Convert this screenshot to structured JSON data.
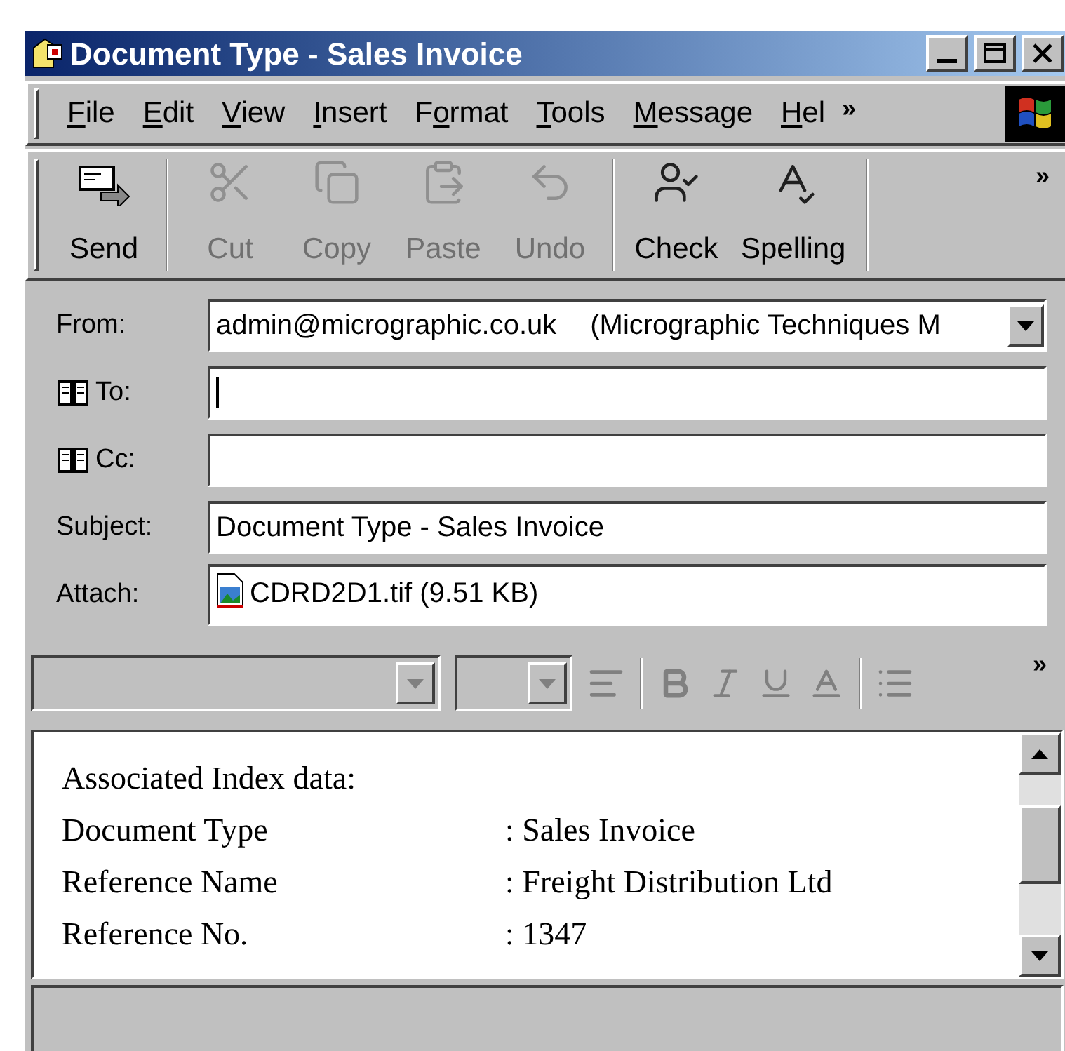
{
  "window": {
    "title": "Document Type - Sales Invoice"
  },
  "menu": [
    {
      "key": "F",
      "after": "ile"
    },
    {
      "key": "E",
      "after": "dit"
    },
    {
      "key": "V",
      "after": "iew"
    },
    {
      "key": "I",
      "after": "nsert"
    },
    {
      "before": "F",
      "key": "o",
      "after": "rmat"
    },
    {
      "key": "T",
      "after": "ools"
    },
    {
      "key": "M",
      "after": "essage"
    },
    {
      "key": "H",
      "after": "el"
    }
  ],
  "menu_overflow": "»",
  "toolbar": [
    {
      "kind": "send",
      "label": "Send",
      "disabled": false
    },
    {
      "kind": "cut",
      "label": "Cut",
      "disabled": true
    },
    {
      "kind": "copy",
      "label": "Copy",
      "disabled": true
    },
    {
      "kind": "paste",
      "label": "Paste",
      "disabled": true
    },
    {
      "kind": "undo",
      "label": "Undo",
      "disabled": true
    },
    {
      "kind": "check",
      "label": "Check",
      "disabled": false
    },
    {
      "kind": "spelling",
      "label": "Spelling",
      "disabled": false
    }
  ],
  "toolbar_overflow": "»",
  "header": [
    {
      "kind": "dropdown",
      "label": "From:",
      "value": "admin@micrographic.co.uk",
      "extra": "(Micrographic Techniques M"
    },
    {
      "kind": "address",
      "label": "To:"
    },
    {
      "kind": "address",
      "label": "Cc:"
    },
    {
      "kind": "text",
      "label": "Subject:",
      "value": "Document Type - Sales Invoice"
    },
    {
      "kind": "attach",
      "label": "Attach:",
      "value": "CDRD2D1.tif (9.51 KB)"
    }
  ],
  "format_toolbar": {
    "disabled": true,
    "overflow": "»"
  },
  "body": {
    "heading": "Associated Index data:",
    "rows": [
      {
        "label": "Document Type",
        "value": ": Sales Invoice"
      },
      {
        "label": "Reference Name",
        "value": ": Freight Distribution Ltd"
      },
      {
        "label": "Reference No.",
        "value": ": 1347"
      }
    ]
  }
}
